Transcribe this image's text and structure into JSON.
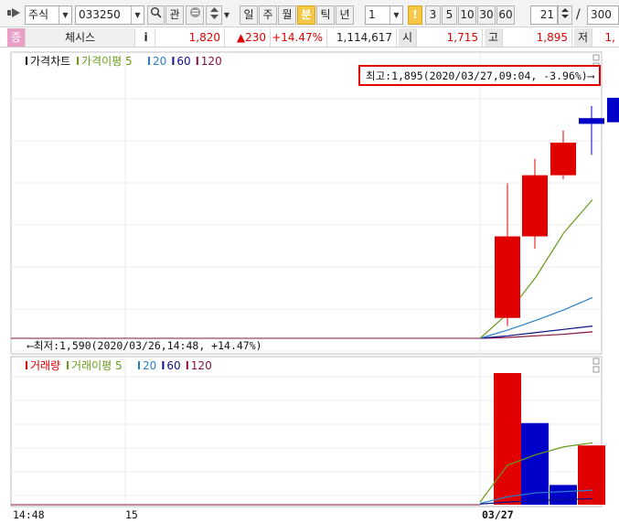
{
  "toolbar": {
    "market": "주식",
    "code": "033250",
    "search_icon": "magnifier-icon",
    "watch_label": "관",
    "periods": [
      "일",
      "주",
      "월",
      "분",
      "틱",
      "년"
    ],
    "active_period": "분",
    "interval_value": "1",
    "minute_badge": "!",
    "minute_steps": [
      "3",
      "5",
      "10",
      "30",
      "60"
    ],
    "count_value": "21",
    "slash": "/",
    "total_value": "300"
  },
  "info": {
    "badge": "증",
    "stock_name": "체시스",
    "info_icon": "i",
    "price": "1,820",
    "change": "▲230",
    "change_pct": "+14.47%",
    "volume": "1,114,617",
    "open_label": "시",
    "open_value": "1,715",
    "high_label": "고",
    "high_value": "1,895",
    "low_label": "저",
    "low_value": "1,"
  },
  "colors": {
    "up": "#e00000",
    "down": "#0000c8",
    "ma5": "#6a9a1a",
    "ma20": "#2a80c8",
    "ma60": "#10108a",
    "ma120": "#8a1040",
    "highlight": "#e00000"
  },
  "price_panel": {
    "legend": [
      {
        "label": "가격차트",
        "color": "#111111"
      },
      {
        "label": "가격이평 5",
        "color": "#6a9a1a"
      },
      {
        "label": "20",
        "color": "#2a80c8"
      },
      {
        "label": "60",
        "color": "#10108a"
      },
      {
        "label": "120",
        "color": "#8a1040"
      }
    ],
    "high_annotation": "최고:1,895(2020/03/27,09:04, -3.96%)⟶",
    "low_annotation": "⟵최저:1,590(2020/03/26,14:48, +14.47%)",
    "candles": [
      {
        "open": 1615,
        "high": 1780,
        "low": 1605,
        "close": 1715
      },
      {
        "open": 1715,
        "high": 1810,
        "low": 1700,
        "close": 1790
      },
      {
        "open": 1790,
        "high": 1845,
        "low": 1785,
        "close": 1830
      },
      {
        "open": 1860,
        "high": 1875,
        "low": 1815,
        "close": 1853
      },
      {
        "open": 1885,
        "high": 1895,
        "low": 1805,
        "close": 1855
      }
    ],
    "ma5": [
      1590,
      1620,
      1665,
      1720,
      1760
    ],
    "ma20": [
      1590,
      1600,
      1612,
      1625,
      1640
    ],
    "ma60": [
      1590,
      1593,
      1597,
      1601,
      1605
    ],
    "ma120": [
      1590,
      1591,
      1593,
      1595,
      1598
    ]
  },
  "volume_panel": {
    "legend": [
      {
        "label": "거래량",
        "color": "#e00000"
      },
      {
        "label": "거래이평 5",
        "color": "#6a9a1a"
      },
      {
        "label": "20",
        "color": "#2a80c8"
      },
      {
        "label": "60",
        "color": "#10108a"
      },
      {
        "label": "120",
        "color": "#8a1040"
      }
    ],
    "bars": [
      {
        "value": 100,
        "color": "#e00000"
      },
      {
        "value": 62,
        "color": "#0000c8"
      },
      {
        "value": 15,
        "color": "#0000c8"
      },
      {
        "value": 45,
        "color": "#e00000"
      }
    ],
    "ma5": [
      2,
      30,
      38,
      44,
      47
    ],
    "ma20": [
      1,
      6,
      9,
      10,
      11
    ],
    "ma60": [
      0.5,
      2,
      3,
      4,
      4.5
    ]
  },
  "x_axis": {
    "labels": [
      "14:48",
      "15",
      "03/27"
    ]
  }
}
